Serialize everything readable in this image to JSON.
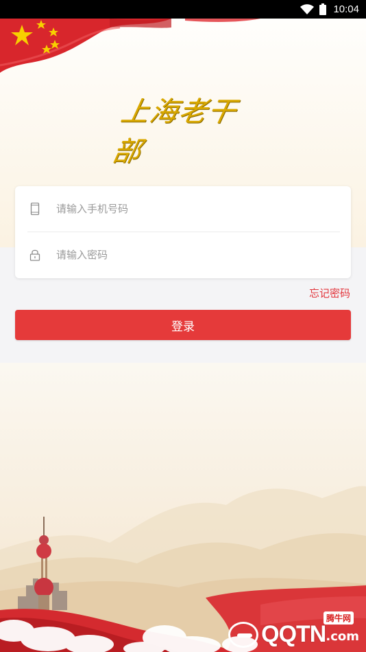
{
  "status_bar": {
    "time": "10:04"
  },
  "logo": {
    "text": "上海老干部"
  },
  "login_form": {
    "phone_placeholder": "请输入手机号码",
    "password_placeholder": "请输入密码",
    "forgot_label": "忘记密码",
    "login_label": "登录"
  },
  "watermark": {
    "main": "QQTN",
    "suffix": ".com",
    "tag": "腾牛网"
  },
  "colors": {
    "accent": "#e53a3a",
    "forgot_text": "#e2333a",
    "logo_gold": "#d9a800",
    "flag_red": "#d8262c"
  },
  "icons": {
    "phone_field": "phone-icon",
    "password_field": "lock-icon",
    "status": [
      "wifi-icon",
      "battery-icon"
    ]
  }
}
